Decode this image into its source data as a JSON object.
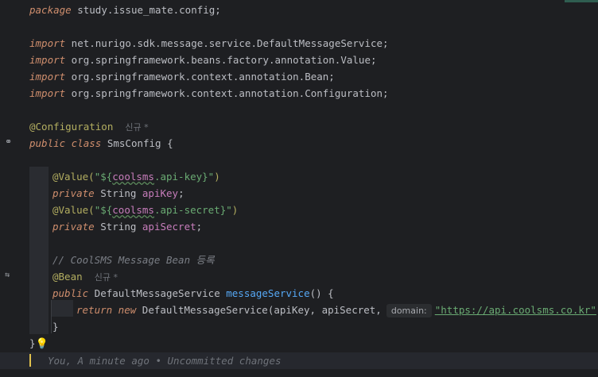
{
  "editor": {
    "lines": {
      "package_kw": "package",
      "package_name": " study.issue_mate.config;",
      "import_kw": "import",
      "imp1_pkg": " net.nurigo.sdk.message.service.",
      "imp1_cls": "DefaultMessageService",
      "imp2_pkg": " org.springframework.beans.factory.annotation.",
      "imp2_cls": "Value",
      "imp3_pkg": " org.springframework.context.annotation.",
      "imp3_cls": "Bean",
      "imp4_pkg": " org.springframework.context.annotation.",
      "imp4_cls": "Configuration",
      "semicolon": ";",
      "config_ann": "@Configuration",
      "new_hint": "신규 *",
      "class_kw": "public class",
      "class_name": " SmsConfig {",
      "value_ann": "@Value(",
      "str_open": "\"${",
      "ref_coolsms": "coolsms",
      "apikey_prop": ".api-key}\"",
      "apisecret_prop": ".api-secret}\"",
      "close_paren": ")",
      "private_kw": "private",
      "string_type": " String ",
      "field_apikey": "apiKey",
      "field_apisecret": "apiSecret",
      "comment_text": "// CoolSMS Message Bean 등록",
      "bean_ann": "@Bean",
      "public_kw": "public",
      "return_type": " DefaultMessageService ",
      "method_name": "messageService",
      "method_tail": "() {",
      "return_kw": "return new",
      "ctor_cls": " DefaultMessageService",
      "args": "(apiKey, apiSecret,",
      "inlay_domain": "domain:",
      "url": "\"https://api.coolsms.co.kr\"",
      "ctor_end": ");",
      "brace_close_inner": "}",
      "brace_close_outer": "}"
    },
    "blame": "You, A minute ago • Uncommitted changes",
    "icons": [
      "bean-gutter-icon",
      "method-gutter-icon",
      "lightbulb-icon"
    ]
  }
}
